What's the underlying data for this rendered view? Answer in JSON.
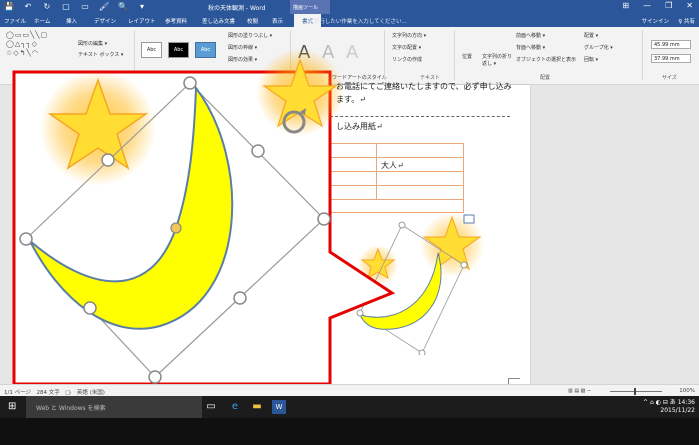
{
  "titlebar": {
    "title": "秋の天体観測 - Word",
    "context_tools": "描画ツール",
    "qat": [
      "💾",
      "↶",
      "↻",
      "▢",
      "▭",
      "🖌",
      "🔍",
      "▾"
    ],
    "win_controls": [
      "⊞",
      "—",
      "❐",
      "✕"
    ]
  },
  "tabs": {
    "items": [
      "ファイル",
      "ホーム",
      "挿入",
      "デザイン",
      "レイアウト",
      "参考資料",
      "差し込み文書",
      "校閲",
      "表示"
    ],
    "active": "書式",
    "tellme": "♀ 実行したい作業を入力してください...",
    "signin": "サインイン",
    "share": "♀ 共有"
  },
  "ribbon": {
    "edit_shape": "図形の編集 ▾",
    "text_box": "テキスト ボックス ▾",
    "style_abc": [
      "Abc",
      "Abc",
      "Abc"
    ],
    "fill": "図形の塗りつぶし ▾",
    "outline": "図形の枠線 ▾",
    "effects": "図形の効果 ▾",
    "wordart_style_label": "ワードアートのスタイル",
    "text_direction": "文字列の方向 ▾",
    "align_text": "文字の配置 ▾",
    "create_link": "リンクの作成",
    "text_group": "テキスト",
    "position": "位置",
    "wrap": "文字列の折り返し ▾",
    "bring_forward": "前面へ移動 ▾",
    "send_backward": "背面へ移動 ▾",
    "selection_pane": "オブジェクトの選択と表示",
    "align": "配置 ▾",
    "group": "グループ化 ▾",
    "rotate": "回転 ▾",
    "arrange_group": "配置",
    "height": "45.99 mm",
    "width": "37.99 mm",
    "size_group": "サイズ"
  },
  "document": {
    "line1": "お電話にてご連絡いたしますので、必ず申し込み",
    "line2": "ます。↵",
    "form_title": "し込み用紙↵",
    "cell_adult": "大人↵"
  },
  "statusbar": {
    "left": "1/1 ページ　284 文字　□ᵢ　英語 (米国)",
    "right": "100%"
  },
  "taskbar": {
    "search": "Web と Windows を検索",
    "time": "14:36",
    "date": "2015/11/22"
  },
  "colors": {
    "word_blue": "#2b579a",
    "moon_fill": "#ffff00",
    "callout_red": "#e60000"
  }
}
